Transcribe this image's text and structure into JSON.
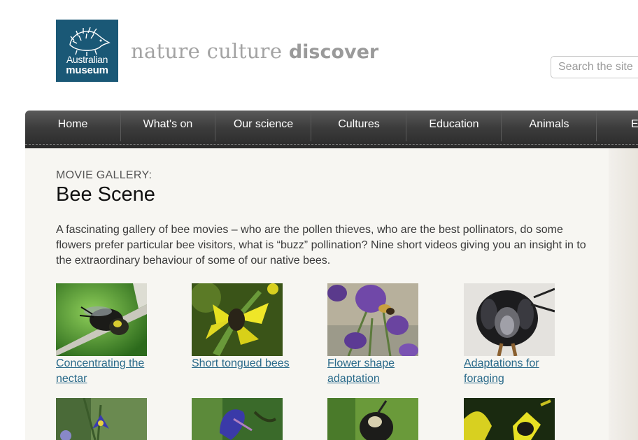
{
  "header": {
    "logo": {
      "line1": "Australian",
      "line2": "museum"
    },
    "tagline": {
      "plain": "nature culture ",
      "bold": "discover"
    },
    "search": {
      "placeholder": "Search the site"
    }
  },
  "nav": {
    "items": [
      {
        "label": "Home"
      },
      {
        "label": "What's on"
      },
      {
        "label": "Our science"
      },
      {
        "label": "Cultures"
      },
      {
        "label": "Education"
      },
      {
        "label": "Animals"
      },
      {
        "label": "E"
      }
    ]
  },
  "main": {
    "section_label": "MOVIE GALLERY:",
    "title": "Bee Scene",
    "intro": "A fascinating gallery of bee movies – who are the pollen thieves, who are the best pollinators, do some flowers prefer particular bee visitors, what is “buzz” pollination? Nine short videos giving you an insight in to the extraordinary behaviour of some of our native bees.",
    "gallery": [
      {
        "title_line1": "Concentrating the",
        "title_line2": "nectar"
      },
      {
        "title_line1": "Short tongued bees",
        "title_line2": ""
      },
      {
        "title_line1": "Flower shape",
        "title_line2": "adaptation"
      },
      {
        "title_line1": "Adaptations for",
        "title_line2": "foraging"
      }
    ]
  },
  "colors": {
    "logo_bg": "#1a5876",
    "link": "#2a6a8a",
    "nav_bg": "#3c3c3c"
  }
}
